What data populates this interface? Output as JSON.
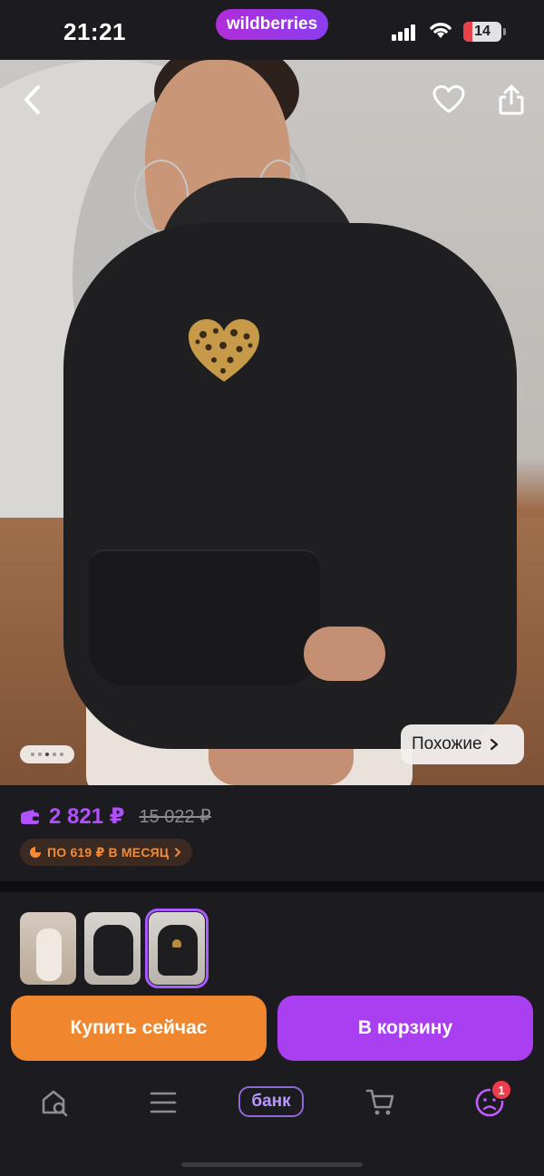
{
  "status_bar": {
    "time": "21:21",
    "brand": "wildberries",
    "battery_level": "14",
    "icons": [
      "cellular-signal-icon",
      "wifi-icon",
      "battery-icon"
    ]
  },
  "product_photo": {
    "back_icon": "chevron-left-icon",
    "favorite_icon": "heart-outline-icon",
    "share_icon": "share-icon",
    "pager": {
      "total": 5,
      "active": 3
    },
    "similar_label": "Похожие"
  },
  "price": {
    "current": "2 821 ₽",
    "old": "15 022 ₽",
    "installment": "ПО 619 ₽ В МЕСЯЦ",
    "wallet_icon": "wallet-icon",
    "installment_icon": "pie-chart-icon"
  },
  "variants": {
    "thumbnails": [
      "light-outfit-photo",
      "black-hoodie-flatlay",
      "black-hoodie-heart-print"
    ],
    "selected_index": 2
  },
  "actions": {
    "buy_now": "Купить сейчас",
    "add_to_cart": "В корзину"
  },
  "tabbar": {
    "items": [
      {
        "icon": "home-search-icon"
      },
      {
        "icon": "menu-icon"
      },
      {
        "label": "банк"
      },
      {
        "icon": "cart-icon"
      },
      {
        "icon": "profile-icon",
        "badge": "1"
      }
    ]
  },
  "colors": {
    "accent_purple": "#a93ff0",
    "accent_orange": "#f0872f",
    "price_purple": "#b24fff",
    "background": "#1c1b20",
    "badge_red": "#ef3b4b"
  }
}
